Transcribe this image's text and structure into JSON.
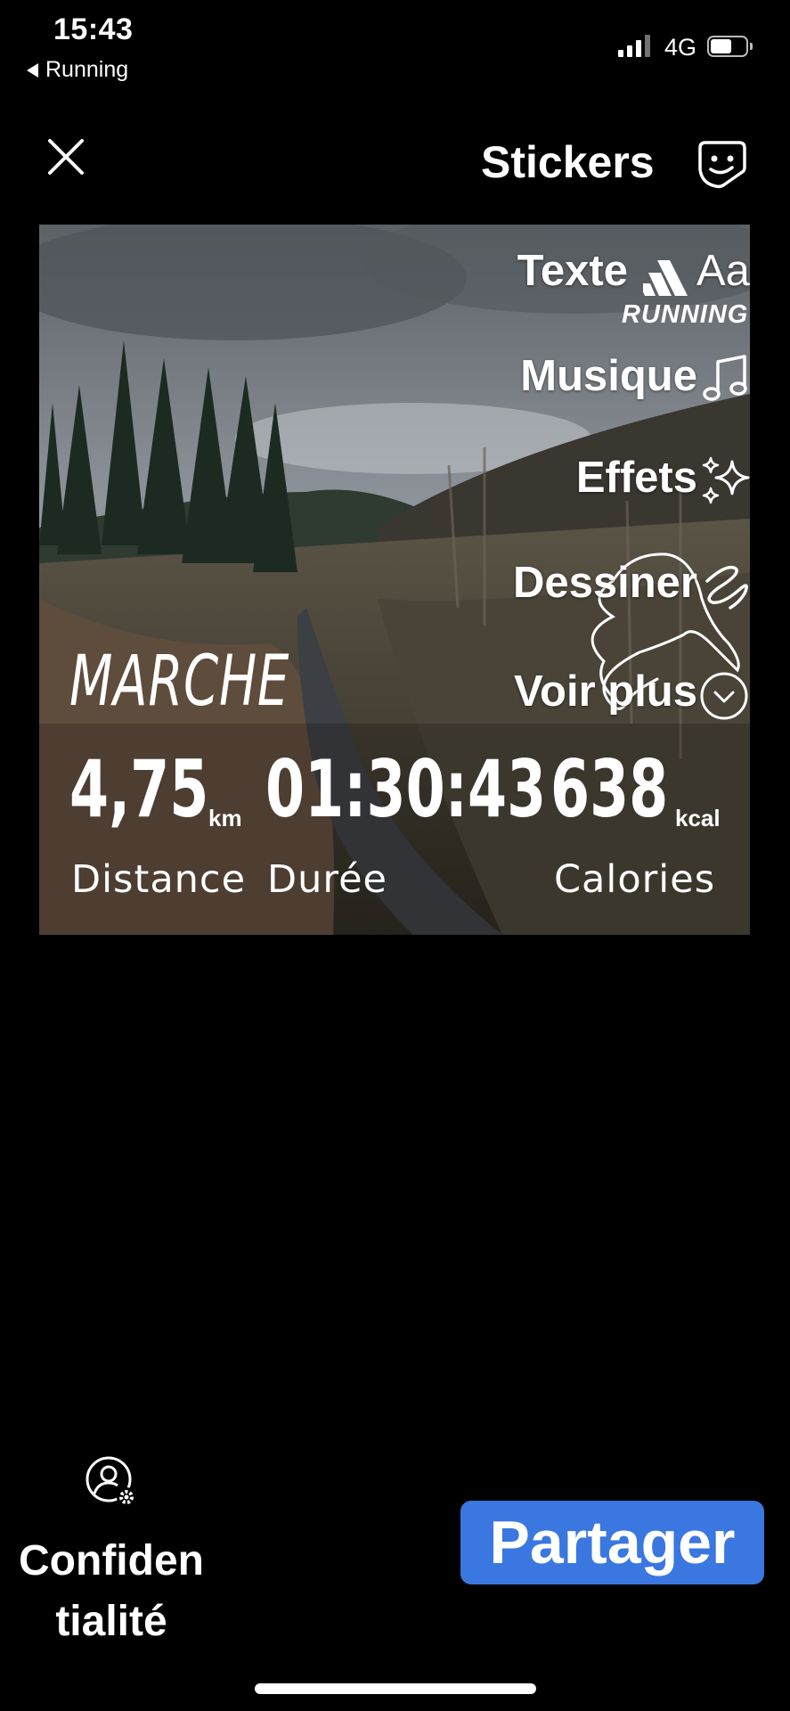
{
  "status_bar": {
    "time": "15:43",
    "back_app": "Running",
    "network": "4G",
    "battery_level": 0.6
  },
  "header": {
    "close_icon": "close-icon",
    "title": "Stickers",
    "stickers_icon": "sticker-face-icon"
  },
  "toolbar": {
    "text_label": "Texte",
    "text_icon_glyph": "Aa",
    "music_label": "Musique",
    "effects_label": "Effets",
    "draw_label": "Dessiner",
    "more_label": "Voir plus"
  },
  "overlay": {
    "brand_text": "RUNNING",
    "activity": "MARCHE",
    "stats": [
      {
        "value": "4,75",
        "unit": "km",
        "label": "Distance"
      },
      {
        "value": "01:30:43",
        "unit": "",
        "label": "Durée"
      },
      {
        "value": "638",
        "unit": "kcal",
        "label": "Calories"
      }
    ]
  },
  "footer": {
    "privacy_label": "Confidentialité",
    "share_label": "Partager"
  },
  "colors": {
    "background": "#000000",
    "share_button": "#3a77e0"
  }
}
